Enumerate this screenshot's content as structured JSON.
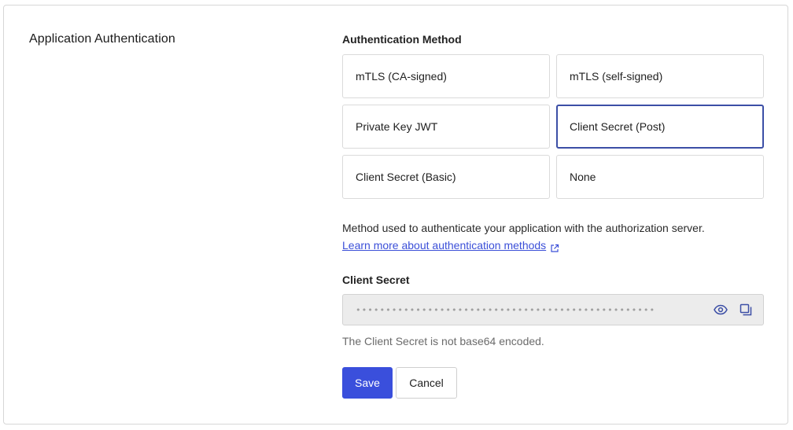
{
  "section": {
    "title": "Application Authentication"
  },
  "auth_method": {
    "label": "Authentication Method",
    "options": [
      {
        "label": "mTLS (CA-signed)",
        "selected": false
      },
      {
        "label": "mTLS (self-signed)",
        "selected": false
      },
      {
        "label": "Private Key JWT",
        "selected": false
      },
      {
        "label": "Client Secret (Post)",
        "selected": true
      },
      {
        "label": "Client Secret (Basic)",
        "selected": false
      },
      {
        "label": "None",
        "selected": false
      }
    ],
    "help_text": "Method used to authenticate your application with the authorization server.",
    "learn_more": "Learn more about authentication methods",
    "learn_more_icon": "external-link-icon"
  },
  "client_secret": {
    "label": "Client Secret",
    "masked_value": "••••••••••••••••••••••••••••••••••••••••••••••••••",
    "reveal_icon": "eye-icon",
    "copy_icon": "copy-icon",
    "note": "The Client Secret is not base64 encoded."
  },
  "actions": {
    "save": "Save",
    "cancel": "Cancel"
  },
  "colors": {
    "primary": "#3a4fdc",
    "link": "#3b4fd8",
    "selected_border": "#3c4fa6",
    "input_bg": "#ececec"
  }
}
